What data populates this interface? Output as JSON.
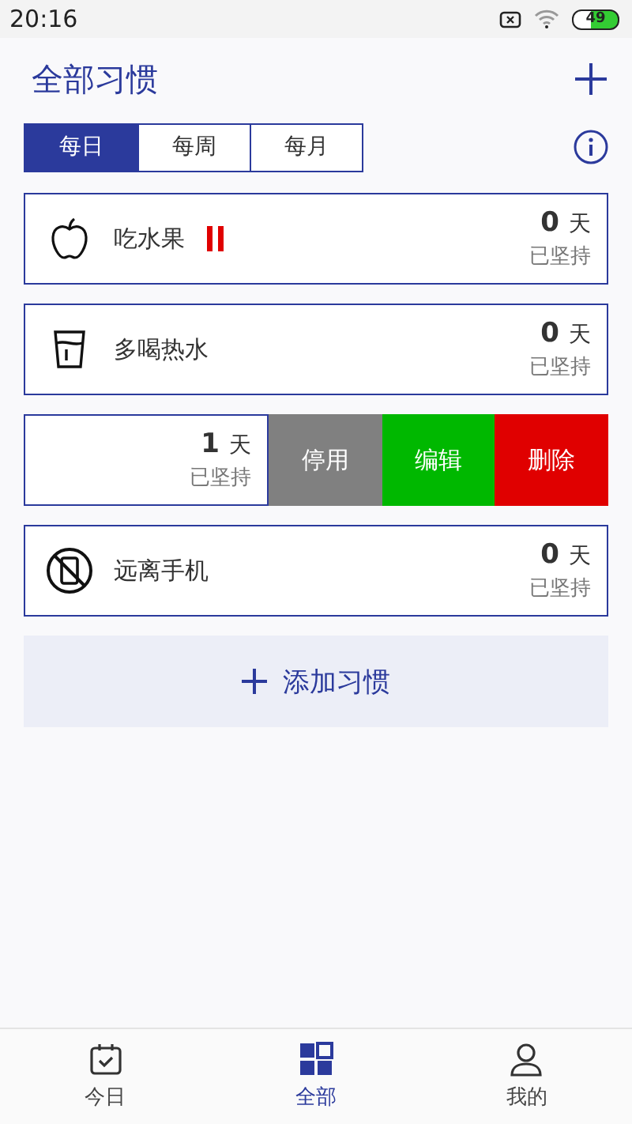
{
  "status_bar": {
    "time": "20:16",
    "battery": "49"
  },
  "header": {
    "title": "全部习惯"
  },
  "tabs": [
    {
      "label": "每日",
      "selected": true
    },
    {
      "label": "每周",
      "selected": false
    },
    {
      "label": "每月",
      "selected": false
    }
  ],
  "habits": [
    {
      "kind": "normal",
      "name": "吃水果",
      "paused": true,
      "count": "0",
      "unit": "天",
      "caption": "已坚持"
    },
    {
      "kind": "normal",
      "name": "多喝热水",
      "paused": false,
      "count": "0",
      "unit": "天",
      "caption": "已坚持"
    },
    {
      "kind": "swiped",
      "count": "1",
      "unit": "天",
      "caption": "已坚持",
      "actions": [
        {
          "label": "停用",
          "color": "#808080"
        },
        {
          "label": "编辑",
          "color": "#00b800"
        },
        {
          "label": "删除",
          "color": "#e00000"
        }
      ]
    },
    {
      "kind": "normal",
      "name": "远离手机",
      "paused": false,
      "count": "0",
      "unit": "天",
      "caption": "已坚持"
    }
  ],
  "add_button": {
    "label": "添加习惯"
  },
  "bottom_nav": [
    {
      "label": "今日",
      "selected": false
    },
    {
      "label": "全部",
      "selected": true
    },
    {
      "label": "我的",
      "selected": false
    }
  ]
}
